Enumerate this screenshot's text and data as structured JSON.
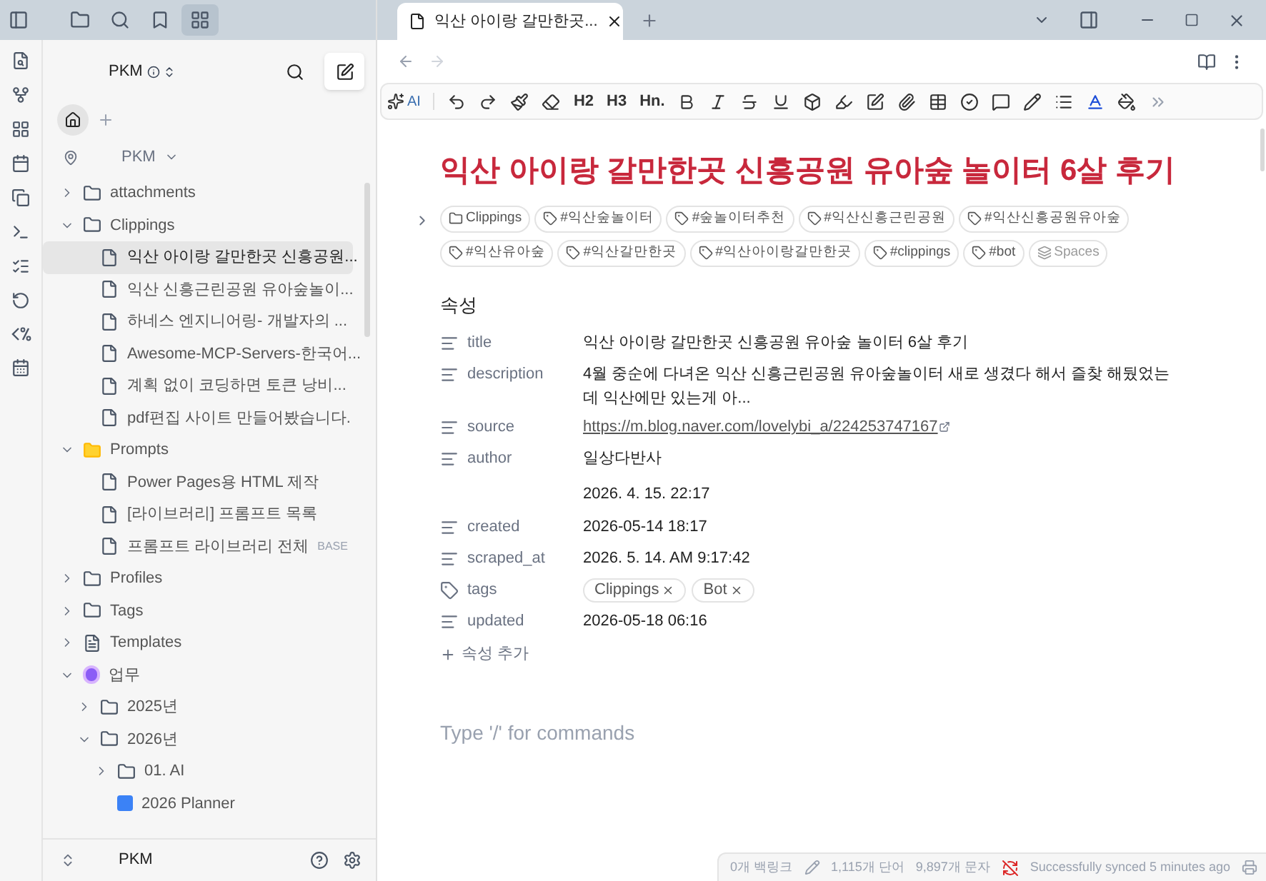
{
  "sidebar": {
    "vault_name": "PKM",
    "root_label": "PKM",
    "tree": [
      {
        "kind": "folder",
        "label": "attachments",
        "expanded": false
      },
      {
        "kind": "folder",
        "label": "Clippings",
        "expanded": true,
        "children": [
          {
            "kind": "file",
            "label": "익산 아이랑 갈만한곳 신흥공원...",
            "selected": true
          },
          {
            "kind": "file",
            "label": "익산 신흥근린공원 유아숲놀이...",
            "selected": false
          },
          {
            "kind": "file",
            "label": "하네스 엔지니어링- 개발자의 ...",
            "selected": false
          },
          {
            "kind": "file",
            "label": "Awesome-MCP-Servers-한국어...",
            "selected": false
          },
          {
            "kind": "file",
            "label": "계획 없이 코딩하면 토큰 낭비...",
            "selected": false
          },
          {
            "kind": "file",
            "label": "pdf편집 사이트 만들어봤습니다.",
            "selected": false
          }
        ]
      },
      {
        "kind": "special-folder",
        "label": "Prompts",
        "expanded": true,
        "children": [
          {
            "kind": "file",
            "label": "Power Pages용 HTML 제작",
            "selected": false
          },
          {
            "kind": "file",
            "label": "[라이브러리] 프롬프트 목록",
            "selected": false
          },
          {
            "kind": "file",
            "label": "프롬프트 라이브러리 전체",
            "badge": "BASE",
            "selected": false
          }
        ]
      },
      {
        "kind": "folder",
        "label": "Profiles",
        "expanded": false
      },
      {
        "kind": "folder",
        "label": "Tags",
        "expanded": false
      },
      {
        "kind": "template-folder",
        "label": "Templates",
        "expanded": false
      },
      {
        "kind": "emoji-folder",
        "label": "업무",
        "expanded": true,
        "children": [
          {
            "kind": "folder",
            "label": "2025년",
            "expanded": false
          },
          {
            "kind": "folder",
            "label": "2026년",
            "expanded": true,
            "children": [
              {
                "kind": "folder",
                "label": "01. AI",
                "expanded": false
              },
              {
                "kind": "planner",
                "label": "2026 Planner",
                "selected": false
              }
            ]
          }
        ]
      }
    ],
    "footer_vault": "PKM"
  },
  "tab": {
    "title": "익산 아이랑 갈만한곳..."
  },
  "toolbar": {
    "ai_label": "AI",
    "heading_buttons": [
      "H2",
      "H3",
      "Hn."
    ]
  },
  "note": {
    "title": "익산 아이랑 갈만한곳 신흥공원 유아숲 놀이터 6살 후기",
    "chips": [
      {
        "kind": "folder",
        "label": "Clippings"
      },
      {
        "kind": "tag",
        "label": "#익산숲놀이터"
      },
      {
        "kind": "tag",
        "label": "#숲놀이터추천"
      },
      {
        "kind": "tag",
        "label": "#익산신흥근린공원"
      },
      {
        "kind": "tag",
        "label": "#익산신흥공원유아숲"
      },
      {
        "kind": "tag",
        "label": "#익산유아숲"
      },
      {
        "kind": "tag",
        "label": "#익산갈만한곳"
      },
      {
        "kind": "tag",
        "label": "#익산아이랑갈만한곳"
      },
      {
        "kind": "tag",
        "label": "#clippings"
      },
      {
        "kind": "tag",
        "label": "#bot"
      },
      {
        "kind": "spaces",
        "label": "Spaces"
      }
    ],
    "properties_heading": "속성",
    "properties": [
      {
        "kind": "text",
        "name": "title",
        "value": "익산 아이랑 갈만한곳 신흥공원 유아숲 놀이터 6살 후기"
      },
      {
        "kind": "text",
        "name": "description",
        "value": "4월 중순에 다녀온 익산 신흥근린공원 유아숲놀이터 새로 생겼다 해서 즐찾 해뒀었는데 익산에만 있는게 아..."
      },
      {
        "kind": "link",
        "name": "source",
        "value": "https://m.blog.naver.com/lovelybi_a/224253747167"
      },
      {
        "kind": "text",
        "name": "author",
        "value": "일상다반사"
      },
      {
        "kind": "bare",
        "value": "2026. 4. 15. 22:17"
      },
      {
        "kind": "text",
        "name": "created",
        "value": "2026-05-14 18:17"
      },
      {
        "kind": "text",
        "name": "scraped_at",
        "value": "2026. 5. 14. AM 9:17:42"
      },
      {
        "kind": "tags",
        "name": "tags",
        "values": [
          "Clippings",
          "Bot"
        ]
      },
      {
        "kind": "text",
        "name": "updated",
        "value": "2026-05-18 06:16"
      }
    ],
    "add_property": "속성 추가",
    "placeholder": "Type '/' for commands"
  },
  "status_bar": {
    "backlinks": "0개 백링크",
    "words": "1,115개 단어",
    "chars": "9,897개 문자",
    "sync": "Successfully synced 5 minutes ago"
  }
}
